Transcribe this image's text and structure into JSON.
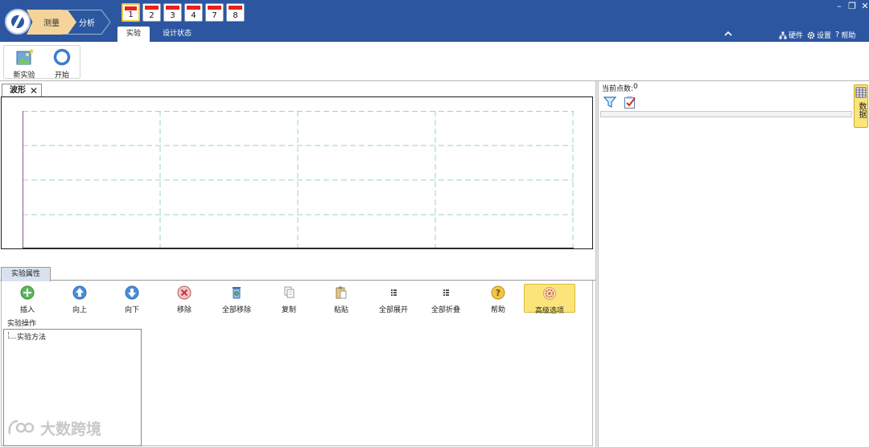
{
  "titlebar": {
    "stages": {
      "measure": "测量",
      "analyze": "分析"
    },
    "channels": [
      {
        "label": "1",
        "selected": true
      },
      {
        "label": "2",
        "selected": false
      },
      {
        "label": "3",
        "selected": false
      },
      {
        "label": "4",
        "selected": false
      },
      {
        "label": "7",
        "selected": false
      },
      {
        "label": "8",
        "selected": false
      }
    ],
    "tabs": {
      "experiment": "实验",
      "design_state": "设计状态"
    },
    "links": {
      "hardware": "硬件",
      "settings": "设置",
      "help": "帮助"
    },
    "window_controls": {
      "minimize": "–",
      "restore": "❐",
      "close": "✕"
    }
  },
  "ribbon": {
    "new_experiment": "新实验",
    "start": "开始"
  },
  "waveform": {
    "tab_label": "波形",
    "close_glyph": "✕"
  },
  "properties": {
    "tab_label": "实验属性",
    "toolbar": [
      {
        "id": "insert",
        "label": "插入",
        "icon": "plus-circle-icon"
      },
      {
        "id": "up",
        "label": "向上",
        "icon": "arrow-up-icon"
      },
      {
        "id": "down",
        "label": "向下",
        "icon": "arrow-down-icon"
      },
      {
        "id": "remove",
        "label": "移除",
        "icon": "remove-icon"
      },
      {
        "id": "remove-all",
        "label": "全部移除",
        "icon": "recycle-bin-icon"
      },
      {
        "id": "copy",
        "label": "复制",
        "icon": "copy-icon"
      },
      {
        "id": "paste",
        "label": "粘贴",
        "icon": "paste-icon"
      },
      {
        "id": "expand-all",
        "label": "全部展开",
        "icon": "expand-icon"
      },
      {
        "id": "collapse-all",
        "label": "全部折叠",
        "icon": "collapse-icon"
      },
      {
        "id": "help",
        "label": "帮助",
        "icon": "help-icon"
      },
      {
        "id": "advanced",
        "label": "高级选项",
        "icon": "advanced-options-icon"
      }
    ],
    "operations_label": "实验操作",
    "tree_item": "实验方法"
  },
  "data_panel": {
    "point_count_label": "当前点数:",
    "point_count_value": "0",
    "side_tab_label": "数据"
  },
  "watermark": "大数跨境",
  "colors": {
    "titlebar": "#2c57a0",
    "stage_active": "#f5d49a",
    "channel_bar": "#e8221f",
    "highlight": "#fbe57a",
    "grid": "#9ad6c4"
  }
}
